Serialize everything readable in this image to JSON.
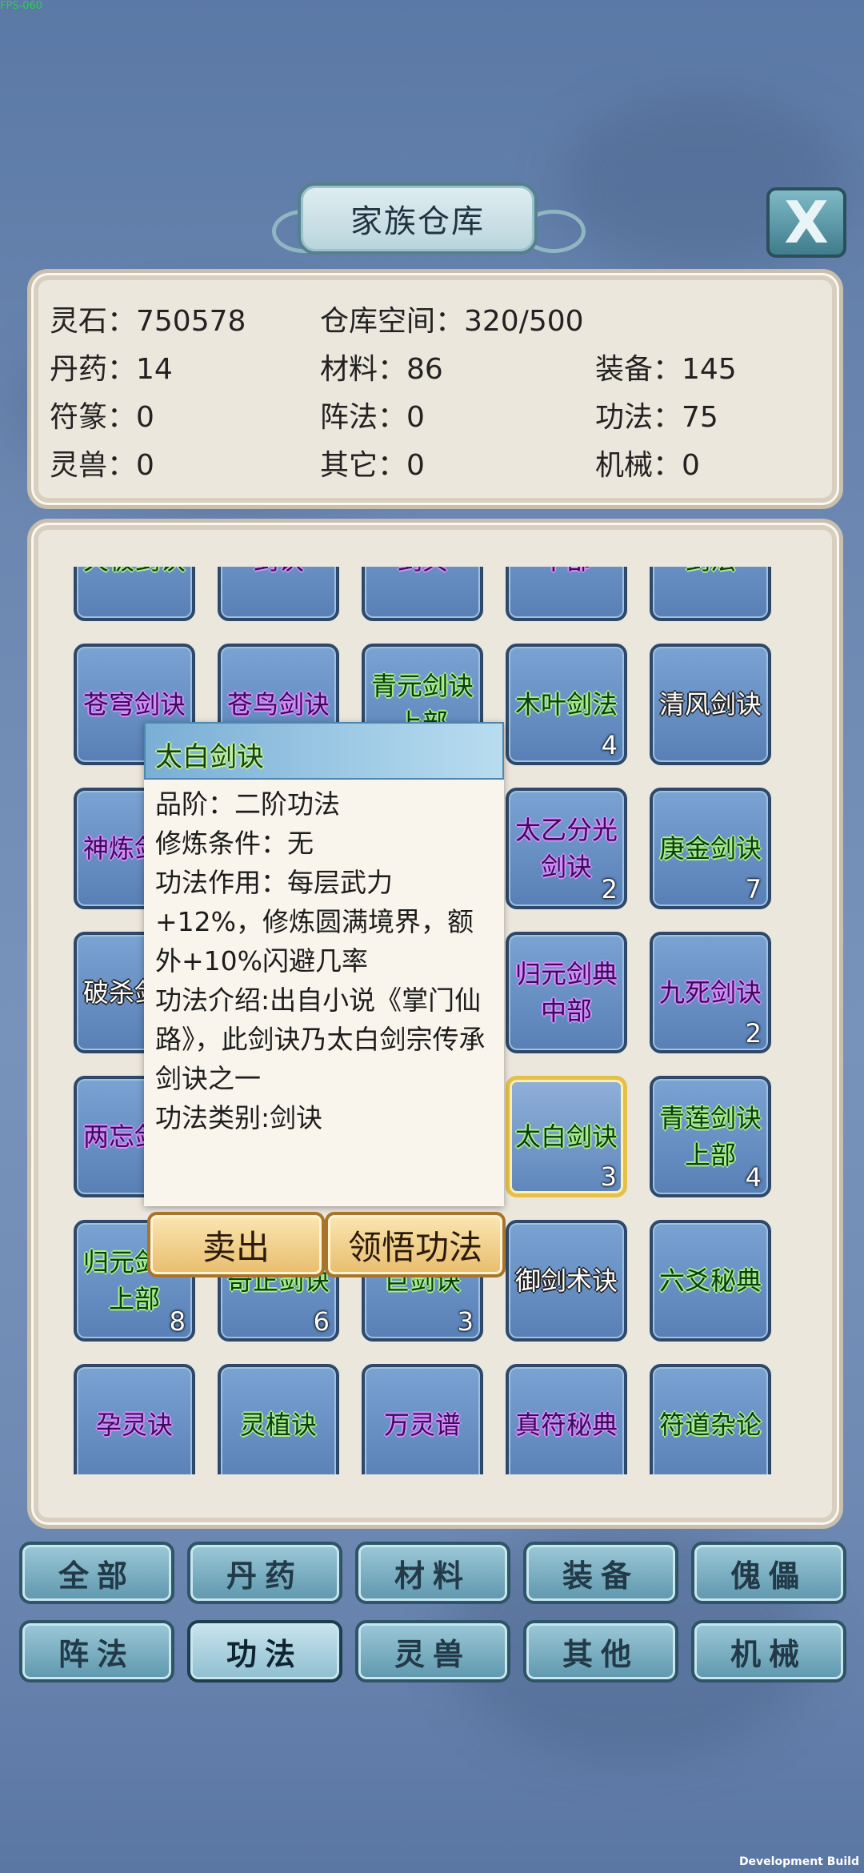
{
  "fps": "FPS-060",
  "build_label": "Development Build",
  "header": {
    "title": "家族仓库",
    "close_label": "X"
  },
  "stats": [
    {
      "label": "灵石：750578",
      "col": 0,
      "row": 0
    },
    {
      "label": "仓库空间：320/500",
      "col": 1,
      "row": 0
    },
    {
      "label": "丹药：14",
      "col": 0,
      "row": 1
    },
    {
      "label": "材料：86",
      "col": 1,
      "row": 1
    },
    {
      "label": "装备：145",
      "col": 2,
      "row": 1
    },
    {
      "label": "符篆：0",
      "col": 0,
      "row": 2
    },
    {
      "label": "阵法：0",
      "col": 1,
      "row": 2
    },
    {
      "label": "功法：75",
      "col": 2,
      "row": 2
    },
    {
      "label": "灵兽：0",
      "col": 0,
      "row": 3
    },
    {
      "label": "其它：0",
      "col": 1,
      "row": 3
    },
    {
      "label": "机械：0",
      "col": 2,
      "row": 3
    }
  ],
  "items": [
    {
      "name": "天极剑诀",
      "count": "",
      "color": "g"
    },
    {
      "name": "剑诀",
      "count": "",
      "color": "p"
    },
    {
      "name": "剑典",
      "count": "",
      "color": "p"
    },
    {
      "name": "中部",
      "count": "",
      "color": "p"
    },
    {
      "name": "剑法",
      "count": "",
      "color": "g"
    },
    {
      "name": "苍穹剑诀",
      "count": "",
      "color": "p"
    },
    {
      "name": "苍鸟剑诀",
      "count": "",
      "color": "p"
    },
    {
      "name": "青元剑诀上部",
      "count": "",
      "color": "g"
    },
    {
      "name": "木叶剑法",
      "count": "4",
      "color": "g"
    },
    {
      "name": "清风剑诀",
      "count": "",
      "color": "w"
    },
    {
      "name": "神炼剑诀",
      "count": "",
      "color": "p"
    },
    {
      "name": "",
      "count": "",
      "color": "p"
    },
    {
      "name": "",
      "count": "",
      "color": "p"
    },
    {
      "name": "太乙分光剑诀",
      "count": "2",
      "color": "p"
    },
    {
      "name": "庚金剑诀",
      "count": "7",
      "color": "g"
    },
    {
      "name": "破杀剑诀",
      "count": "",
      "color": "w"
    },
    {
      "name": "",
      "count": "",
      "color": "p"
    },
    {
      "name": "",
      "count": "",
      "color": "p"
    },
    {
      "name": "归元剑典中部",
      "count": "",
      "color": "p"
    },
    {
      "name": "九死剑诀",
      "count": "2",
      "color": "p"
    },
    {
      "name": "两忘剑诀",
      "count": "",
      "color": "p"
    },
    {
      "name": "",
      "count": "",
      "color": "p"
    },
    {
      "name": "",
      "count": "",
      "color": "p"
    },
    {
      "name": "太白剑诀",
      "count": "3",
      "color": "g",
      "selected": true
    },
    {
      "name": "青莲剑诀上部",
      "count": "4",
      "color": "g"
    },
    {
      "name": "归元剑诀上部",
      "count": "8",
      "color": "g"
    },
    {
      "name": "奇正剑诀",
      "count": "6",
      "color": "g"
    },
    {
      "name": "巨剑诀",
      "count": "3",
      "color": "g"
    },
    {
      "name": "御剑术诀",
      "count": "",
      "color": "w"
    },
    {
      "name": "六爻秘典",
      "count": "",
      "color": "g"
    },
    {
      "name": "孕灵诀",
      "count": "",
      "color": "p"
    },
    {
      "name": "灵植诀",
      "count": "",
      "color": "g"
    },
    {
      "name": "万灵谱",
      "count": "",
      "color": "p"
    },
    {
      "name": "真符秘典",
      "count": "",
      "color": "p"
    },
    {
      "name": "符道杂论",
      "count": "",
      "color": "g"
    }
  ],
  "tooltip": {
    "title": "太白剑诀",
    "lines": [
      "品阶：二阶功法",
      "修炼条件：无",
      "功法作用：每层武力+12%，修炼圆满境界，额外+10%闪避几率",
      "功法介绍:出自小说《掌门仙路》，此剑诀乃太白剑宗传承剑诀之一",
      "功法类别:剑诀"
    ],
    "sell_label": "卖出",
    "learn_label": "领悟功法"
  },
  "tabs": [
    {
      "label": "全部",
      "active": false
    },
    {
      "label": "丹药",
      "active": false
    },
    {
      "label": "材料",
      "active": false
    },
    {
      "label": "装备",
      "active": false
    },
    {
      "label": "傀儡",
      "active": false
    },
    {
      "label": "阵法",
      "active": false
    },
    {
      "label": "功法",
      "active": true
    },
    {
      "label": "灵兽",
      "active": false
    },
    {
      "label": "其他",
      "active": false
    },
    {
      "label": "机械",
      "active": false
    }
  ]
}
